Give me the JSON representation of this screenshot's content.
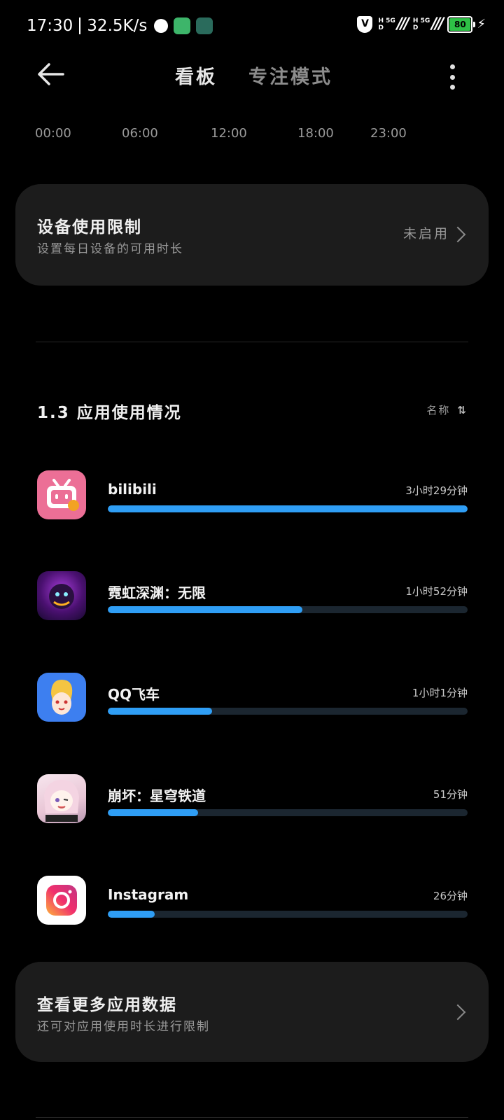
{
  "status_bar": {
    "time": "17:30",
    "net_speed": "32.5K/s",
    "signal_1": {
      "top": "H 5G",
      "bottom": "D"
    },
    "signal_2": {
      "top": "H 5G",
      "bottom": "D"
    },
    "battery": "80",
    "battery_color": "#2ec046"
  },
  "header": {
    "tab_dashboard": "看板",
    "tab_focus": "专注模式"
  },
  "timeline": {
    "ticks": [
      "00:00",
      "06:00",
      "12:00",
      "18:00",
      "23:00"
    ]
  },
  "device_limit": {
    "title": "设备使用限制",
    "subtitle": "设置每日设备的可用时长",
    "status": "未启用"
  },
  "app_usage": {
    "title": "1.3 应用使用情况",
    "sort_label": "名称",
    "accent_color": "#2f9ef5",
    "apps": [
      {
        "name": "bilibili",
        "time": "3小时29分钟",
        "fraction": 1.0,
        "icon": "bilibili-icon"
      },
      {
        "name": "霓虹深渊：无限",
        "time": "1小时52分钟",
        "fraction": 0.54,
        "icon": "neon-abyss-icon"
      },
      {
        "name": "QQ飞车",
        "time": "1小时1分钟",
        "fraction": 0.29,
        "icon": "qq-speed-icon"
      },
      {
        "name": "崩坏：星穹铁道",
        "time": "51分钟",
        "fraction": 0.25,
        "icon": "honkai-star-rail-icon"
      },
      {
        "name": "Instagram",
        "time": "26分钟",
        "fraction": 0.13,
        "icon": "instagram-icon"
      }
    ]
  },
  "more_data": {
    "title": "查看更多应用数据",
    "subtitle": "还可对应用使用时长进行限制"
  }
}
